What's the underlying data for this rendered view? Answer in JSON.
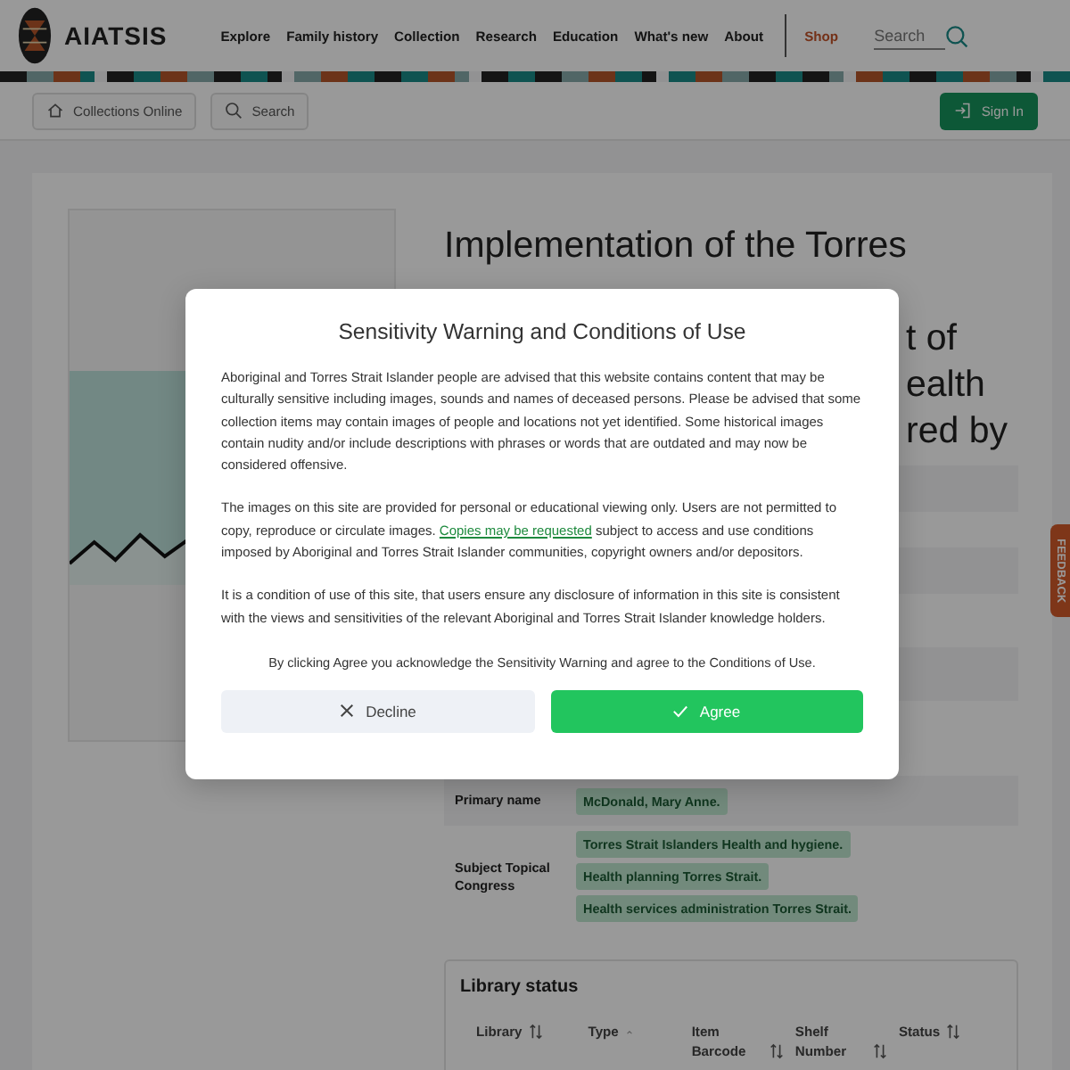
{
  "header": {
    "brand": "AIATSIS",
    "nav": [
      "Explore",
      "Family history",
      "Collection",
      "Research",
      "Education",
      "What's new",
      "About"
    ],
    "shop": "Shop",
    "search": {
      "placeholder": "Search"
    }
  },
  "subnav": {
    "breadcrumbs": [
      {
        "label": "Collections Online",
        "kind": "home"
      },
      {
        "label": "Search",
        "kind": "search"
      }
    ],
    "sign_in": "Sign In"
  },
  "record": {
    "title": "Implementation of the Torres",
    "title_fragments": [
      "t of",
      "ealth",
      "red by"
    ],
    "fields": [
      {
        "label": "Primary name",
        "values": [
          "McDonald, Mary Anne."
        ]
      },
      {
        "label": "Subject Topical Congress",
        "values": [
          "Torres Strait Islanders Health and hygiene.",
          "Health planning Torres Strait.",
          "Health services administration Torres Strait."
        ]
      }
    ]
  },
  "library_status": {
    "title": "Library status",
    "columns": [
      {
        "label": "Library",
        "kind": "sortable"
      },
      {
        "label": "Type",
        "kind": "sorted"
      },
      {
        "label": "Item Barcode",
        "kind": "sortable"
      },
      {
        "label": "Shelf Number",
        "kind": "sortable"
      },
      {
        "label": "Status",
        "kind": "sortable"
      }
    ]
  },
  "feedback": "FEEDBACK",
  "modal": {
    "title": "Sensitivity Warning and Conditions of Use",
    "p1": "Aboriginal and Torres Strait Islander people are advised that this website contains content that may be culturally sensitive including images, sounds and names of deceased persons. Please be advised that some collection items may contain images of people and locations not yet identified. Some historical images contain nudity and/or include descriptions with phrases or words that are outdated and may now be considered offensive.",
    "p2": {
      "before": "The images on this site are provided for personal or educational viewing only. Users are not permitted to copy, reproduce or circulate images.",
      "link": "Copies may be requested",
      "after": "subject to access and use conditions imposed by Aboriginal and Torres Strait Islander communities, copyright owners and/or depositors."
    },
    "p3": "It is a condition of use of this site, that users ensure any disclosure of information in this site is consistent with the views and sensitivities of the relevant Aboriginal and Torres Strait Islander knowledge holders.",
    "notice": "By clicking Agree you acknowledge the Sensitivity Warning and agree to the Conditions of Use.",
    "decline": "Decline",
    "agree": "Agree"
  }
}
